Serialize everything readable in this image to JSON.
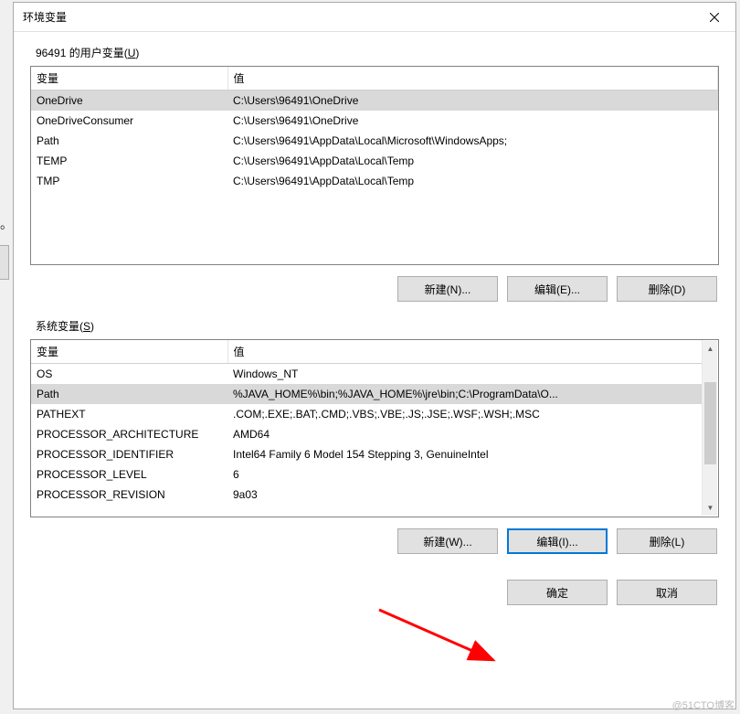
{
  "dialog": {
    "title": "环境变量",
    "close_tooltip": "Close"
  },
  "user_section": {
    "label_prefix": "96491 的用户变量(",
    "label_underline": "U",
    "label_suffix": ")",
    "columns": {
      "var": "变量",
      "val": "值"
    },
    "rows": [
      {
        "var": "OneDrive",
        "val": "C:\\Users\\96491\\OneDrive",
        "selected": true
      },
      {
        "var": "OneDriveConsumer",
        "val": "C:\\Users\\96491\\OneDrive"
      },
      {
        "var": "Path",
        "val": "C:\\Users\\96491\\AppData\\Local\\Microsoft\\WindowsApps;"
      },
      {
        "var": "TEMP",
        "val": "C:\\Users\\96491\\AppData\\Local\\Temp"
      },
      {
        "var": "TMP",
        "val": "C:\\Users\\96491\\AppData\\Local\\Temp"
      }
    ],
    "buttons": {
      "new": "新建(N)...",
      "edit": "编辑(E)...",
      "delete": "删除(D)"
    }
  },
  "sys_section": {
    "label_prefix": "系统变量(",
    "label_underline": "S",
    "label_suffix": ")",
    "columns": {
      "var": "变量",
      "val": "值"
    },
    "rows": [
      {
        "var": "OS",
        "val": "Windows_NT"
      },
      {
        "var": "Path",
        "val": "%JAVA_HOME%\\bin;%JAVA_HOME%\\jre\\bin;C:\\ProgramData\\O...",
        "selected": true
      },
      {
        "var": "PATHEXT",
        "val": ".COM;.EXE;.BAT;.CMD;.VBS;.VBE;.JS;.JSE;.WSF;.WSH;.MSC"
      },
      {
        "var": "PROCESSOR_ARCHITECTURE",
        "val": "AMD64"
      },
      {
        "var": "PROCESSOR_IDENTIFIER",
        "val": "Intel64 Family 6 Model 154 Stepping 3, GenuineIntel"
      },
      {
        "var": "PROCESSOR_LEVEL",
        "val": "6"
      },
      {
        "var": "PROCESSOR_REVISION",
        "val": "9a03"
      }
    ],
    "buttons": {
      "new": "新建(W)...",
      "edit": "编辑(I)...",
      "delete": "删除(L)"
    }
  },
  "dialog_buttons": {
    "ok": "确定",
    "cancel": "取消"
  },
  "watermark": "@51CTO博客",
  "fragment_dot": "。"
}
